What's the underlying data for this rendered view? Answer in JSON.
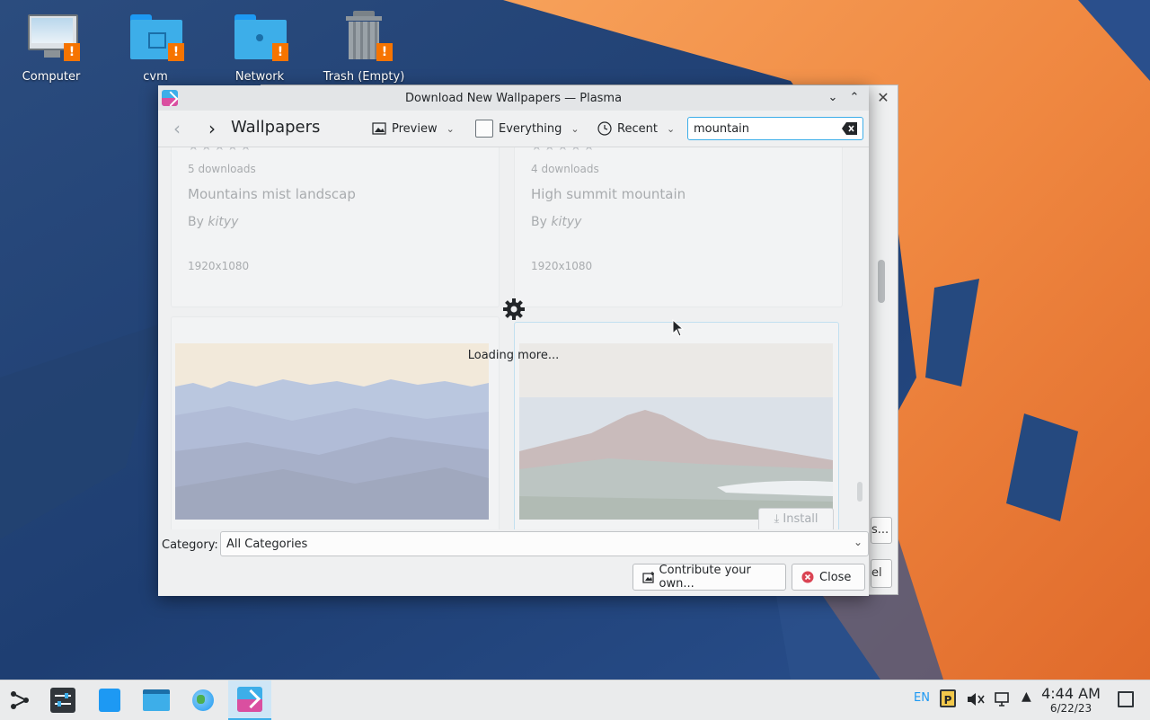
{
  "desktop": {
    "icons": [
      {
        "label": "Computer"
      },
      {
        "label": "cvm"
      },
      {
        "label": "Network"
      },
      {
        "label": "Trash (Empty)"
      }
    ],
    "warning_badge": "!"
  },
  "background_window": {
    "button_fragment_1": "s...",
    "button_fragment_2": "el"
  },
  "dialog": {
    "title": "Download New Wallpapers — Plasma",
    "heading": "Wallpapers",
    "view_mode": "Preview",
    "filter": "Everything",
    "sort": "Recent",
    "search": {
      "value": "mountain",
      "placeholder": ""
    },
    "items": [
      {
        "downloads": "5 downloads",
        "name": "Mountains mist landscap",
        "by_prefix": "By",
        "author": "kityy",
        "resolution": "1920x1080"
      },
      {
        "downloads": "4 downloads",
        "name": "High summit mountain",
        "by_prefix": "By",
        "author": "kityy",
        "resolution": "1920x1080"
      }
    ],
    "loading_text": "Loading more...",
    "install_label": "Install",
    "category_label": "Category:",
    "category_value": "All Categories",
    "contribute_label": "Contribute your own...",
    "close_label": "Close"
  },
  "taskbar": {
    "keyboard_layout": "EN",
    "clock_time": "4:44 AM",
    "clock_date": "6/22/23"
  },
  "colors": {
    "accent": "#3daee9",
    "warning": "#f67400",
    "close_red": "#da4453"
  }
}
